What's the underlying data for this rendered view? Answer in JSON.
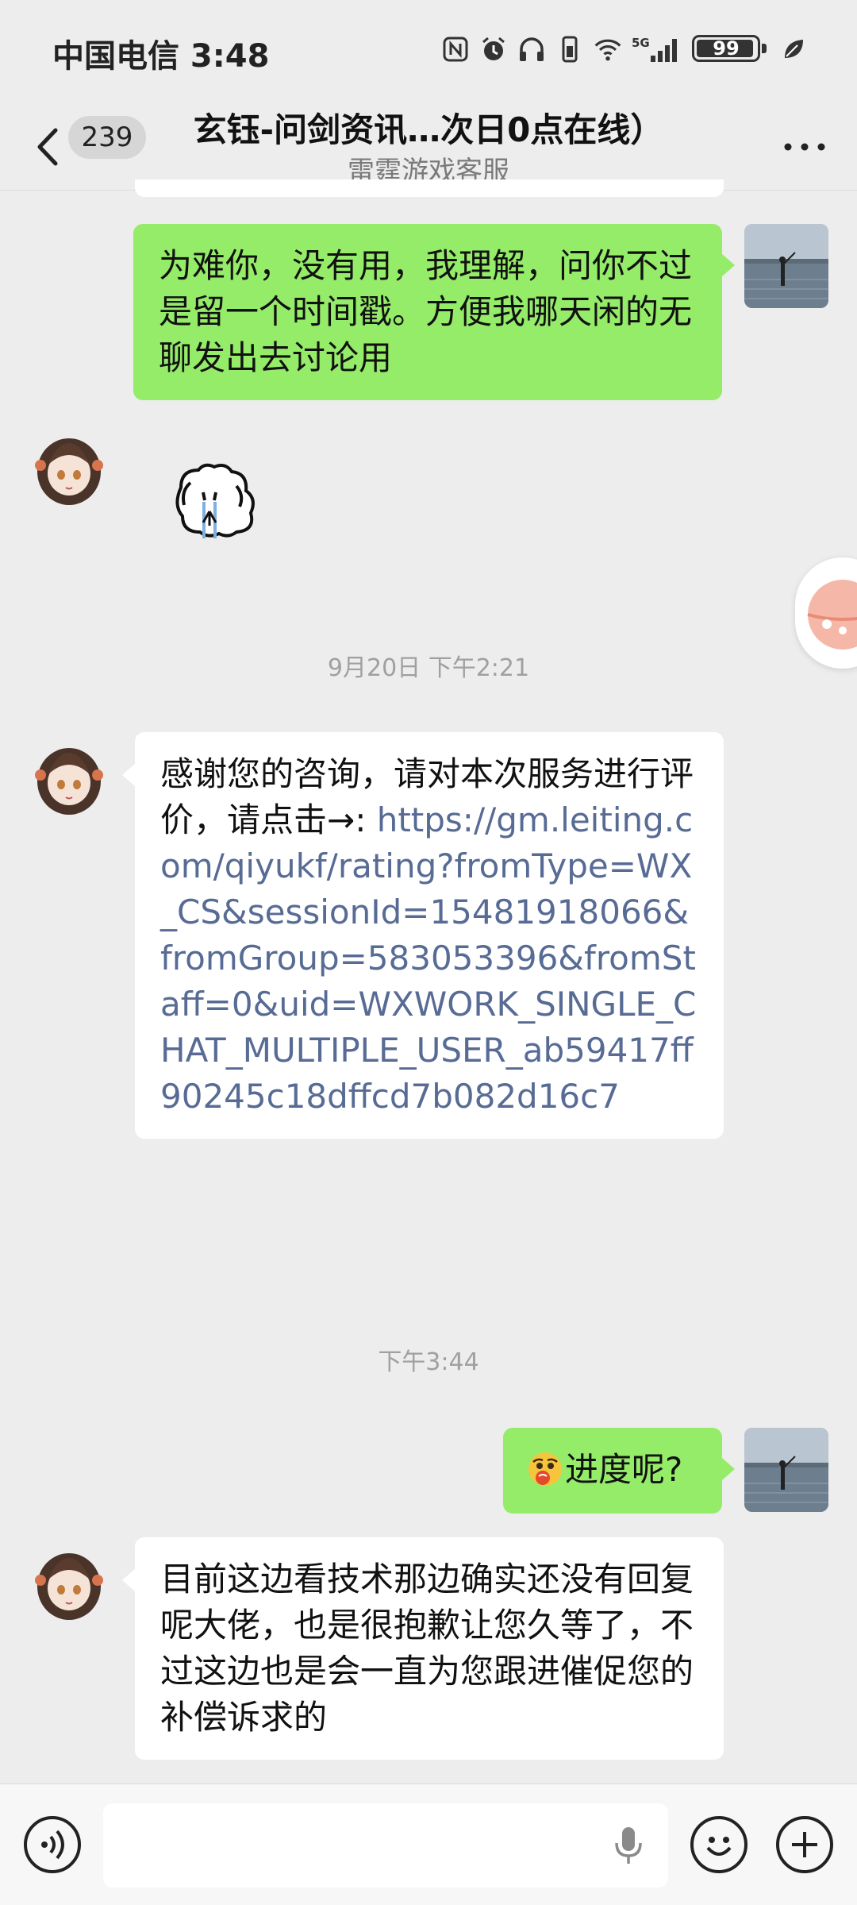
{
  "status_bar": {
    "carrier_time": "中国电信 3:48",
    "icons": [
      "nfc-icon",
      "alarm-icon",
      "headphones-icon",
      "vibrate-icon",
      "wifi-icon",
      "5g-signal-icon"
    ],
    "network": "5G",
    "battery": "99",
    "battery_level": 0.99
  },
  "header": {
    "unread_count": "239",
    "title": "玄钰-问剑资讯…次日0点在线）",
    "subtitle": "雷霆游戏客服"
  },
  "messages": {
    "m1": "为难你，没有用，我理解，问你不过是留一个时间戳。方便我哪天闲的无聊发出去讨论用",
    "time1": "9月20日 下午2:21",
    "m3_text": "感谢您的咨询，请对本次服务进行评价，请点击→: ",
    "m3_link": "https://gm.leiting.com/qiyukf/rating?fromType=WX_CS&sessionId=15481918066&fromGroup=583053396&fromStaff=0&uid=WXWORK_SINGLE_CHAT_MULTIPLE_USER_ab59417ff90245c18dffcd7b082d16c7",
    "time2": "下午3:44",
    "m4": "进度呢?",
    "m5": "目前这边看技术那边确实还没有回复呢大佬，也是很抱歉让您久等了，不过这边也是会一直为您跟进催促您的补偿诉求的"
  },
  "colors": {
    "self_bubble": "#95ec69",
    "other_bubble": "#ffffff",
    "link": "#576b95",
    "background": "#ededed"
  }
}
